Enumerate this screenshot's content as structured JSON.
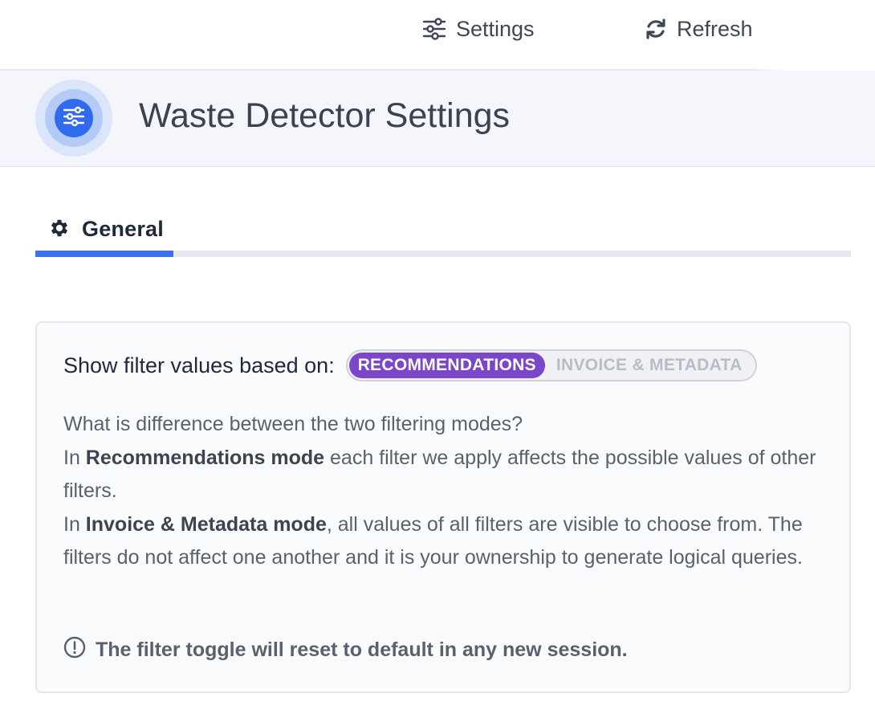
{
  "topbar": {
    "settings_label": "Settings",
    "refresh_label": "Refresh",
    "settings_icon": "sliders-icon",
    "refresh_icon": "refresh-icon"
  },
  "header": {
    "title": "Waste Detector Settings",
    "icon": "sliders-icon"
  },
  "tabs": [
    {
      "label": "General",
      "icon": "gear-icon",
      "active": true
    }
  ],
  "filter": {
    "label": "Show filter values based on:",
    "options": [
      {
        "label": "RECOMMENDATIONS",
        "selected": true
      },
      {
        "label": "INVOICE & METADATA",
        "selected": false
      }
    ]
  },
  "description": {
    "question": "What is difference between the two filtering modes?",
    "rec_prefix": "In ",
    "rec_bold": "Recommendations mode",
    "rec_text": " each filter we apply affects the possible values of other filters.",
    "inv_prefix": "In ",
    "inv_bold": "Invoice & Metadata mode",
    "inv_text": ", all values of all filters are visible to choose from. The filters do not affect one another and it is your ownership to generate logical queries."
  },
  "notice": {
    "icon": "info-circle-icon",
    "text": "The filter toggle will reset to default in any new session."
  },
  "colors": {
    "accent_blue": "#3c72ef",
    "toggle_purple": "#7b46c9",
    "header_bg": "#f5f6fc"
  }
}
